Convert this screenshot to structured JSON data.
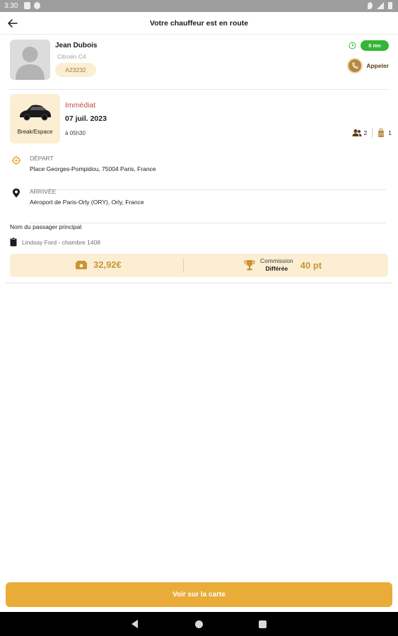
{
  "status_bar": {
    "time": "3:30"
  },
  "app_bar": {
    "title": "Votre chauffeur est en route",
    "back_icon": "arrow-left-icon"
  },
  "driver": {
    "name": "Jean Dubois",
    "car": "Citroën C4",
    "plate": "A23232",
    "eta": "0 mn",
    "call_label": "Appeler"
  },
  "ride": {
    "vehicle_type": "Break/Espace",
    "when": "Immédiat",
    "date": "07 juil. 2023",
    "time": "à 05h30",
    "passengers": "2",
    "luggage": "1"
  },
  "departure": {
    "label": "DÉPART",
    "address": "Place Georges-Pompidou, 75004 Paris, France"
  },
  "arrival": {
    "label": "ARRIVÉE",
    "address": "Aéroport de Paris-Orly (ORY), Orly, France"
  },
  "passenger": {
    "label": "Nom du passager principal",
    "value": "Lindsay Ford  - chambre 1408"
  },
  "pricing": {
    "price": "32,92€",
    "commission_label": "Commission",
    "commission_mode": "Différée",
    "points": "40 pt"
  },
  "actions": {
    "map_button": "Voir sur la carte"
  },
  "colors": {
    "accent": "#e9ac38",
    "accent_light": "#fbeed3",
    "urgent": "#c9483e",
    "eta_green": "#35b535"
  }
}
